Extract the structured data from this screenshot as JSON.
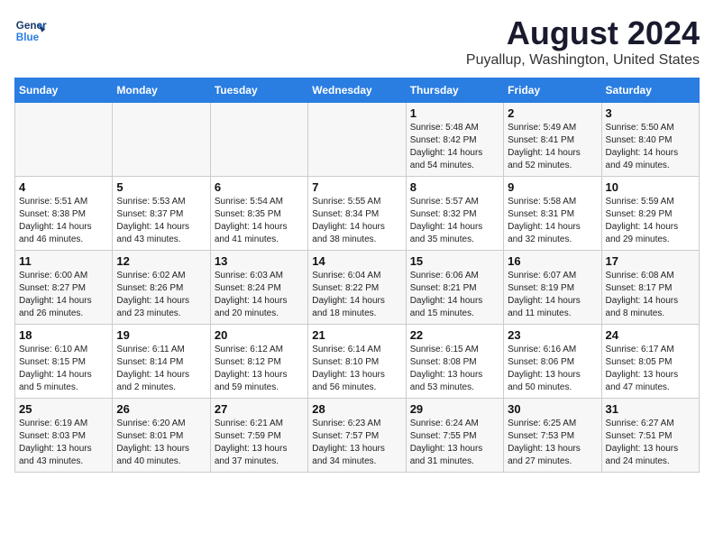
{
  "header": {
    "logo_line1": "General",
    "logo_line2": "Blue",
    "title": "August 2024",
    "subtitle": "Puyallup, Washington, United States"
  },
  "weekdays": [
    "Sunday",
    "Monday",
    "Tuesday",
    "Wednesday",
    "Thursday",
    "Friday",
    "Saturday"
  ],
  "weeks": [
    [
      {
        "day": "",
        "content": ""
      },
      {
        "day": "",
        "content": ""
      },
      {
        "day": "",
        "content": ""
      },
      {
        "day": "",
        "content": ""
      },
      {
        "day": "1",
        "content": "Sunrise: 5:48 AM\nSunset: 8:42 PM\nDaylight: 14 hours\nand 54 minutes."
      },
      {
        "day": "2",
        "content": "Sunrise: 5:49 AM\nSunset: 8:41 PM\nDaylight: 14 hours\nand 52 minutes."
      },
      {
        "day": "3",
        "content": "Sunrise: 5:50 AM\nSunset: 8:40 PM\nDaylight: 14 hours\nand 49 minutes."
      }
    ],
    [
      {
        "day": "4",
        "content": "Sunrise: 5:51 AM\nSunset: 8:38 PM\nDaylight: 14 hours\nand 46 minutes."
      },
      {
        "day": "5",
        "content": "Sunrise: 5:53 AM\nSunset: 8:37 PM\nDaylight: 14 hours\nand 43 minutes."
      },
      {
        "day": "6",
        "content": "Sunrise: 5:54 AM\nSunset: 8:35 PM\nDaylight: 14 hours\nand 41 minutes."
      },
      {
        "day": "7",
        "content": "Sunrise: 5:55 AM\nSunset: 8:34 PM\nDaylight: 14 hours\nand 38 minutes."
      },
      {
        "day": "8",
        "content": "Sunrise: 5:57 AM\nSunset: 8:32 PM\nDaylight: 14 hours\nand 35 minutes."
      },
      {
        "day": "9",
        "content": "Sunrise: 5:58 AM\nSunset: 8:31 PM\nDaylight: 14 hours\nand 32 minutes."
      },
      {
        "day": "10",
        "content": "Sunrise: 5:59 AM\nSunset: 8:29 PM\nDaylight: 14 hours\nand 29 minutes."
      }
    ],
    [
      {
        "day": "11",
        "content": "Sunrise: 6:00 AM\nSunset: 8:27 PM\nDaylight: 14 hours\nand 26 minutes."
      },
      {
        "day": "12",
        "content": "Sunrise: 6:02 AM\nSunset: 8:26 PM\nDaylight: 14 hours\nand 23 minutes."
      },
      {
        "day": "13",
        "content": "Sunrise: 6:03 AM\nSunset: 8:24 PM\nDaylight: 14 hours\nand 20 minutes."
      },
      {
        "day": "14",
        "content": "Sunrise: 6:04 AM\nSunset: 8:22 PM\nDaylight: 14 hours\nand 18 minutes."
      },
      {
        "day": "15",
        "content": "Sunrise: 6:06 AM\nSunset: 8:21 PM\nDaylight: 14 hours\nand 15 minutes."
      },
      {
        "day": "16",
        "content": "Sunrise: 6:07 AM\nSunset: 8:19 PM\nDaylight: 14 hours\nand 11 minutes."
      },
      {
        "day": "17",
        "content": "Sunrise: 6:08 AM\nSunset: 8:17 PM\nDaylight: 14 hours\nand 8 minutes."
      }
    ],
    [
      {
        "day": "18",
        "content": "Sunrise: 6:10 AM\nSunset: 8:15 PM\nDaylight: 14 hours\nand 5 minutes."
      },
      {
        "day": "19",
        "content": "Sunrise: 6:11 AM\nSunset: 8:14 PM\nDaylight: 14 hours\nand 2 minutes."
      },
      {
        "day": "20",
        "content": "Sunrise: 6:12 AM\nSunset: 8:12 PM\nDaylight: 13 hours\nand 59 minutes."
      },
      {
        "day": "21",
        "content": "Sunrise: 6:14 AM\nSunset: 8:10 PM\nDaylight: 13 hours\nand 56 minutes."
      },
      {
        "day": "22",
        "content": "Sunrise: 6:15 AM\nSunset: 8:08 PM\nDaylight: 13 hours\nand 53 minutes."
      },
      {
        "day": "23",
        "content": "Sunrise: 6:16 AM\nSunset: 8:06 PM\nDaylight: 13 hours\nand 50 minutes."
      },
      {
        "day": "24",
        "content": "Sunrise: 6:17 AM\nSunset: 8:05 PM\nDaylight: 13 hours\nand 47 minutes."
      }
    ],
    [
      {
        "day": "25",
        "content": "Sunrise: 6:19 AM\nSunset: 8:03 PM\nDaylight: 13 hours\nand 43 minutes."
      },
      {
        "day": "26",
        "content": "Sunrise: 6:20 AM\nSunset: 8:01 PM\nDaylight: 13 hours\nand 40 minutes."
      },
      {
        "day": "27",
        "content": "Sunrise: 6:21 AM\nSunset: 7:59 PM\nDaylight: 13 hours\nand 37 minutes."
      },
      {
        "day": "28",
        "content": "Sunrise: 6:23 AM\nSunset: 7:57 PM\nDaylight: 13 hours\nand 34 minutes."
      },
      {
        "day": "29",
        "content": "Sunrise: 6:24 AM\nSunset: 7:55 PM\nDaylight: 13 hours\nand 31 minutes."
      },
      {
        "day": "30",
        "content": "Sunrise: 6:25 AM\nSunset: 7:53 PM\nDaylight: 13 hours\nand 27 minutes."
      },
      {
        "day": "31",
        "content": "Sunrise: 6:27 AM\nSunset: 7:51 PM\nDaylight: 13 hours\nand 24 minutes."
      }
    ]
  ]
}
